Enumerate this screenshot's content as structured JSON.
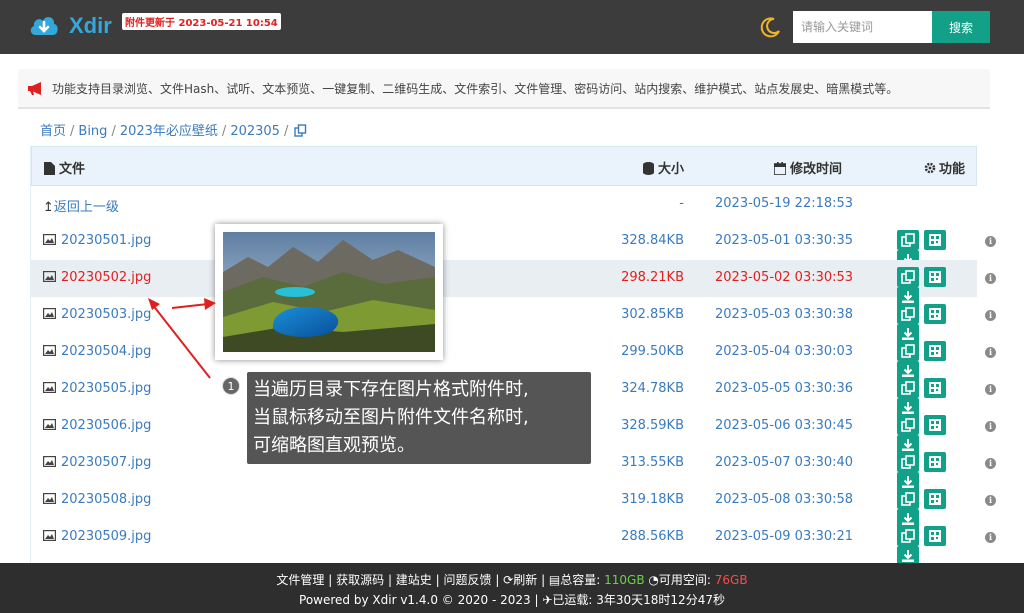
{
  "header": {
    "brand": "Xdir",
    "update_badge": "附件更新于 2023-05-21 10:54",
    "search_placeholder": "请输入关键词",
    "search_button": "搜索"
  },
  "notice": {
    "text": "功能支持目录浏览、文件Hash、试听、文本预览、一键复制、二维码生成、文件索引、文件管理、密码访问、站内搜索、维护模式、站点发展史、暗黑模式等。"
  },
  "breadcrumb": {
    "items": [
      "首页",
      "Bing",
      "2023年必应壁纸",
      "202305"
    ]
  },
  "table": {
    "headers": {
      "name": "文件",
      "size": "大小",
      "time": "修改时间",
      "actions": "功能"
    },
    "parent_row": {
      "name": "返回上一级",
      "size": "-",
      "time": "2023-05-19 22:18:53"
    },
    "rows": [
      {
        "name": "20230501.jpg",
        "size": "328.84KB",
        "time": "2023-05-01 03:30:35"
      },
      {
        "name": "20230502.jpg",
        "size": "298.21KB",
        "time": "2023-05-02 03:30:53"
      },
      {
        "name": "20230503.jpg",
        "size": "302.85KB",
        "time": "2023-05-03 03:30:38"
      },
      {
        "name": "20230504.jpg",
        "size": "299.50KB",
        "time": "2023-05-04 03:30:03"
      },
      {
        "name": "20230505.jpg",
        "size": "324.78KB",
        "time": "2023-05-05 03:30:36"
      },
      {
        "name": "20230506.jpg",
        "size": "328.59KB",
        "time": "2023-05-06 03:30:45"
      },
      {
        "name": "20230507.jpg",
        "size": "313.55KB",
        "time": "2023-05-07 03:30:40"
      },
      {
        "name": "20230508.jpg",
        "size": "319.18KB",
        "time": "2023-05-08 03:30:58"
      },
      {
        "name": "20230509.jpg",
        "size": "288.56KB",
        "time": "2023-05-09 03:30:21"
      }
    ]
  },
  "callout": {
    "number": "1",
    "lines": [
      "当遍历目录下存在图片格式附件时,",
      "当鼠标移动至图片附件文件名称时,",
      "可缩略图直观预览。"
    ]
  },
  "footer": {
    "links": [
      "文件管理",
      "获取源码",
      "建站史",
      "问题反馈"
    ],
    "refresh": "刷新",
    "total_label": "总容量:",
    "total_value": "110GB",
    "free_label": "可用空间:",
    "free_value": "76GB",
    "powered": "Powered by Xdir v1.4.0",
    "copyright": "© 2020 - 2023",
    "uptime_label": "已运载:",
    "uptime_value": "3年30天18时12分47秒"
  },
  "colors": {
    "accent": "#13a089",
    "brand": "#32a8dc",
    "hover_red": "#e02020",
    "link": "#3a7bbf"
  }
}
